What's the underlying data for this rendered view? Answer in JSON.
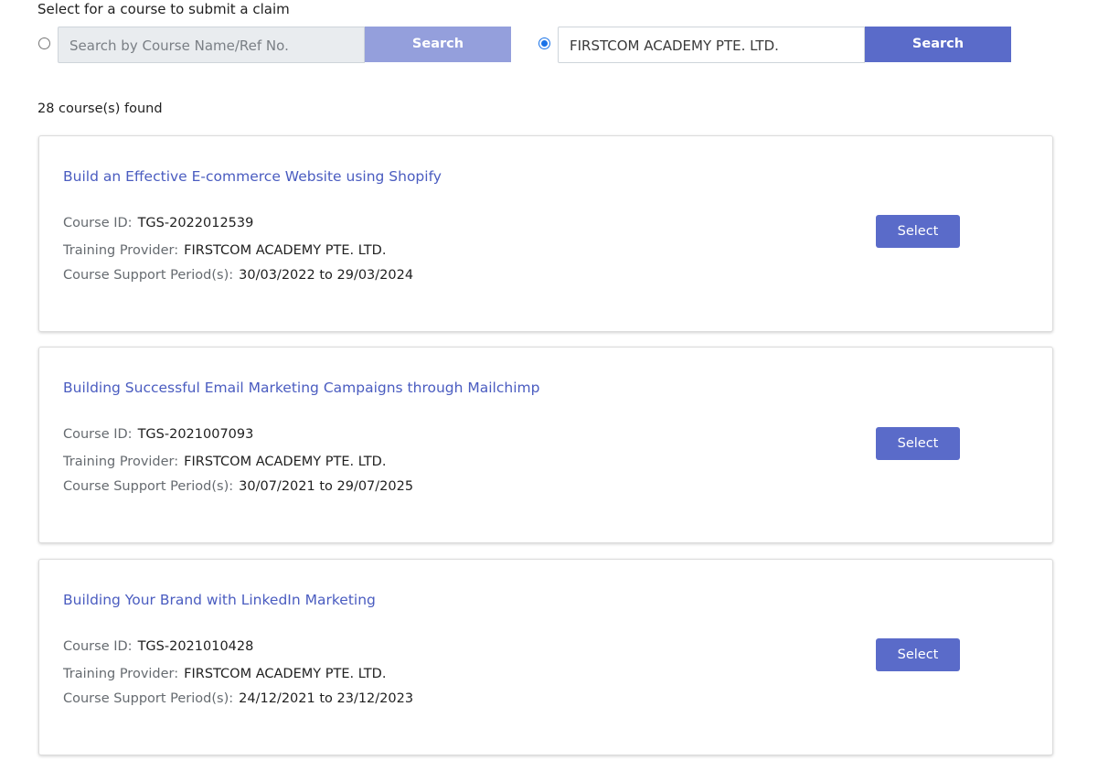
{
  "prompt": "Select for a course to submit a claim",
  "search": {
    "course_option": {
      "placeholder": "Search by Course Name/Ref No.",
      "button_label": "Search",
      "selected": false
    },
    "provider_option": {
      "value": "FIRSTCOM ACADEMY PTE. LTD.",
      "button_label": "Search",
      "selected": true
    }
  },
  "results_count": "28 course(s) found",
  "labels": {
    "course_id": "Course ID:",
    "provider": "Training Provider:",
    "period": "Course Support Period(s):",
    "select": "Select"
  },
  "courses": [
    {
      "title": "Build an Effective E-commerce Website using Shopify",
      "course_id": "TGS-2022012539",
      "provider": "FIRSTCOM ACADEMY PTE. LTD.",
      "period": "30/03/2022 to 29/03/2024"
    },
    {
      "title": "Building Successful Email Marketing Campaigns through Mailchimp",
      "course_id": "TGS-2021007093",
      "provider": "FIRSTCOM ACADEMY PTE. LTD.",
      "period": "30/07/2021 to 29/07/2025"
    },
    {
      "title": "Building Your Brand with LinkedIn Marketing",
      "course_id": "TGS-2021010428",
      "provider": "FIRSTCOM ACADEMY PTE. LTD.",
      "period": "24/12/2021 to 23/12/2023"
    }
  ],
  "colors": {
    "accent": "#5a6bc9",
    "accent_disabled": "#949fdc",
    "title_link": "#4a5cc0"
  }
}
